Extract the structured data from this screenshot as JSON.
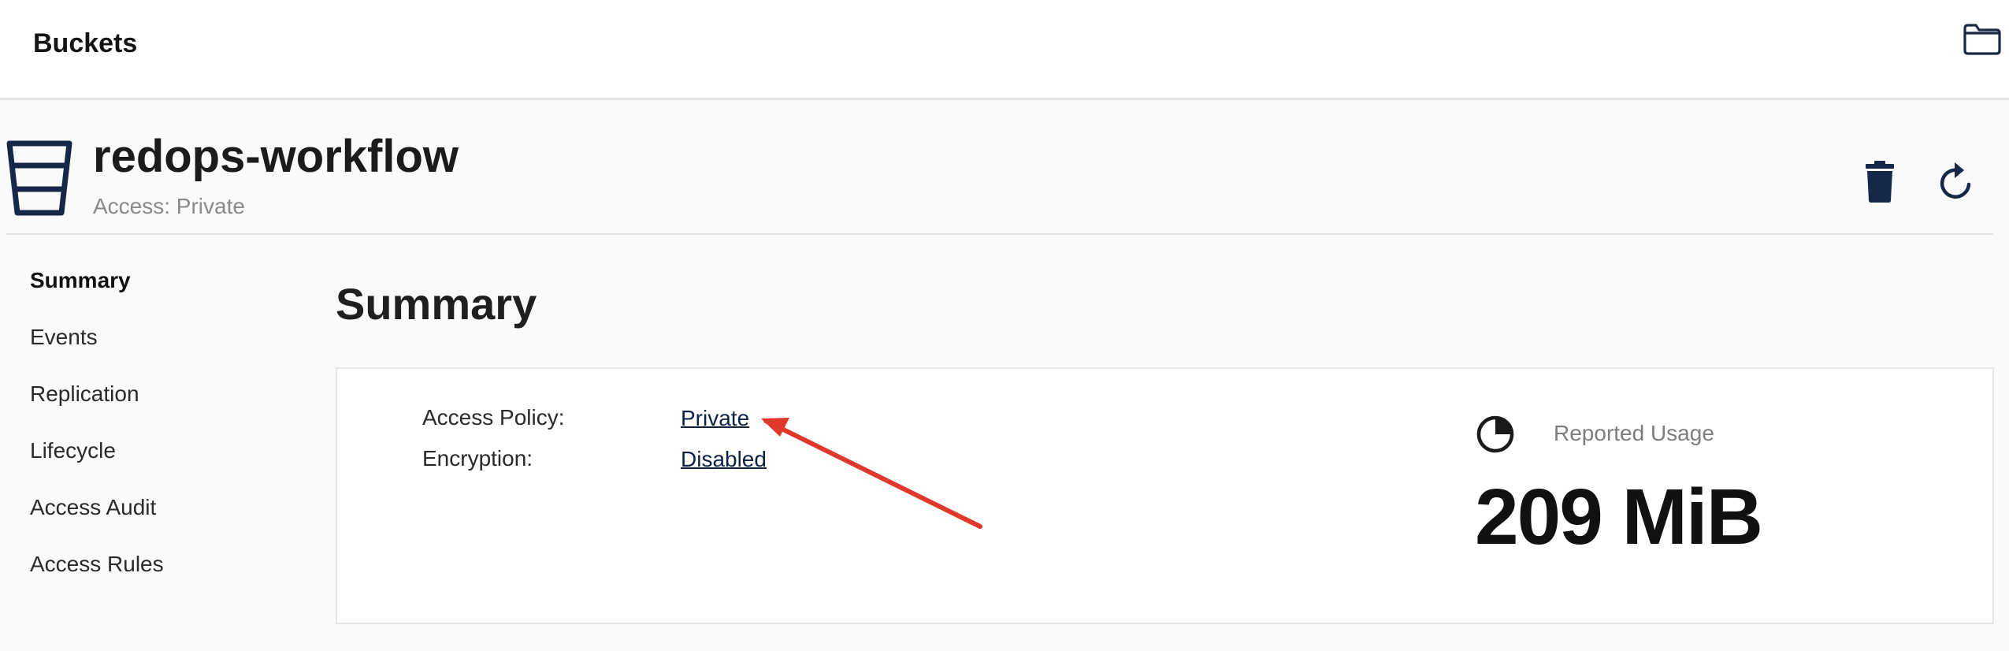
{
  "header": {
    "title": "Buckets",
    "folder_icon": "folder-icon"
  },
  "bucket": {
    "name": "redops-workflow",
    "access_text": "Access: Private",
    "icon": "bucket-icon",
    "actions": {
      "delete_icon": "trash-icon",
      "refresh_icon": "refresh-icon"
    }
  },
  "sidebar": {
    "items": [
      {
        "label": "Summary",
        "active": true
      },
      {
        "label": "Events",
        "active": false
      },
      {
        "label": "Replication",
        "active": false
      },
      {
        "label": "Lifecycle",
        "active": false
      },
      {
        "label": "Access Audit",
        "active": false
      },
      {
        "label": "Access Rules",
        "active": false
      }
    ]
  },
  "main": {
    "title": "Summary",
    "details": [
      {
        "label": "Access Policy:",
        "value": "Private"
      },
      {
        "label": "Encryption:",
        "value": "Disabled"
      }
    ],
    "usage": {
      "label": "Reported Usage",
      "value": "209 MiB",
      "icon": "pie-chart-icon"
    },
    "annotation": {
      "icon": "red-arrow-annotation",
      "color": "#e0392b"
    }
  }
}
